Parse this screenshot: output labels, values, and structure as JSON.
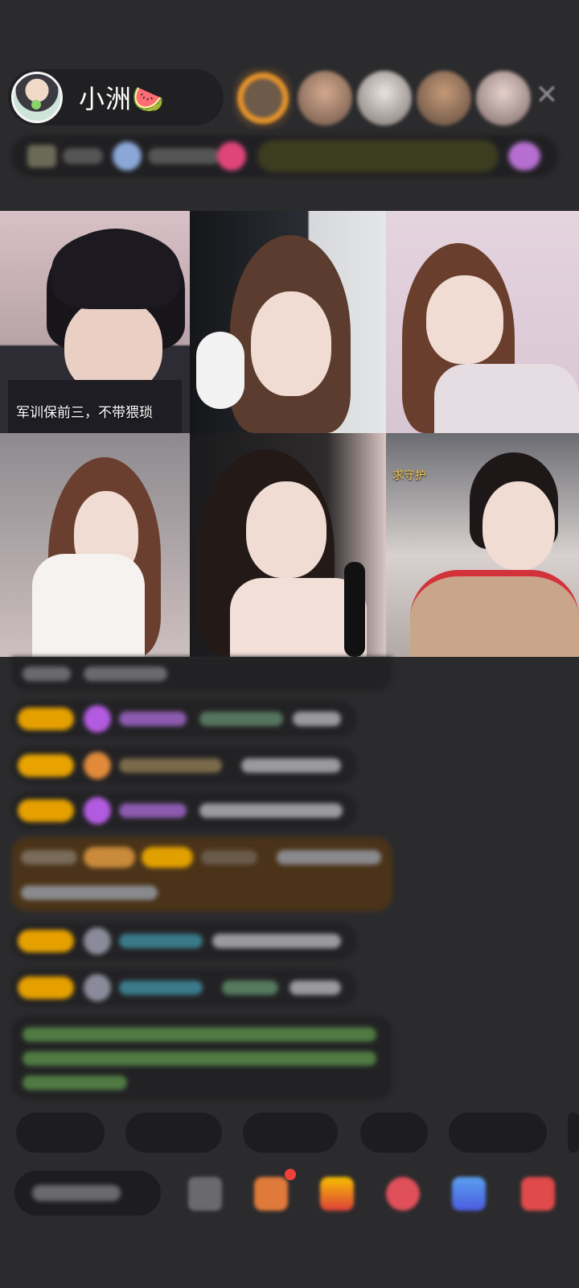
{
  "header": {
    "host_name": "小洲🍉",
    "close_icon": "close-icon"
  },
  "grid": {
    "cells": [
      {
        "caption": "军训保前三，不带猥琐"
      },
      {
        "caption": ""
      },
      {
        "caption": ""
      },
      {
        "caption": ""
      },
      {
        "caption": ""
      },
      {
        "caption": "求守护"
      }
    ]
  },
  "colors": {
    "background": "#2b2b2d",
    "badge": "#e5a000",
    "highlight_msg": "#5a3a14"
  }
}
